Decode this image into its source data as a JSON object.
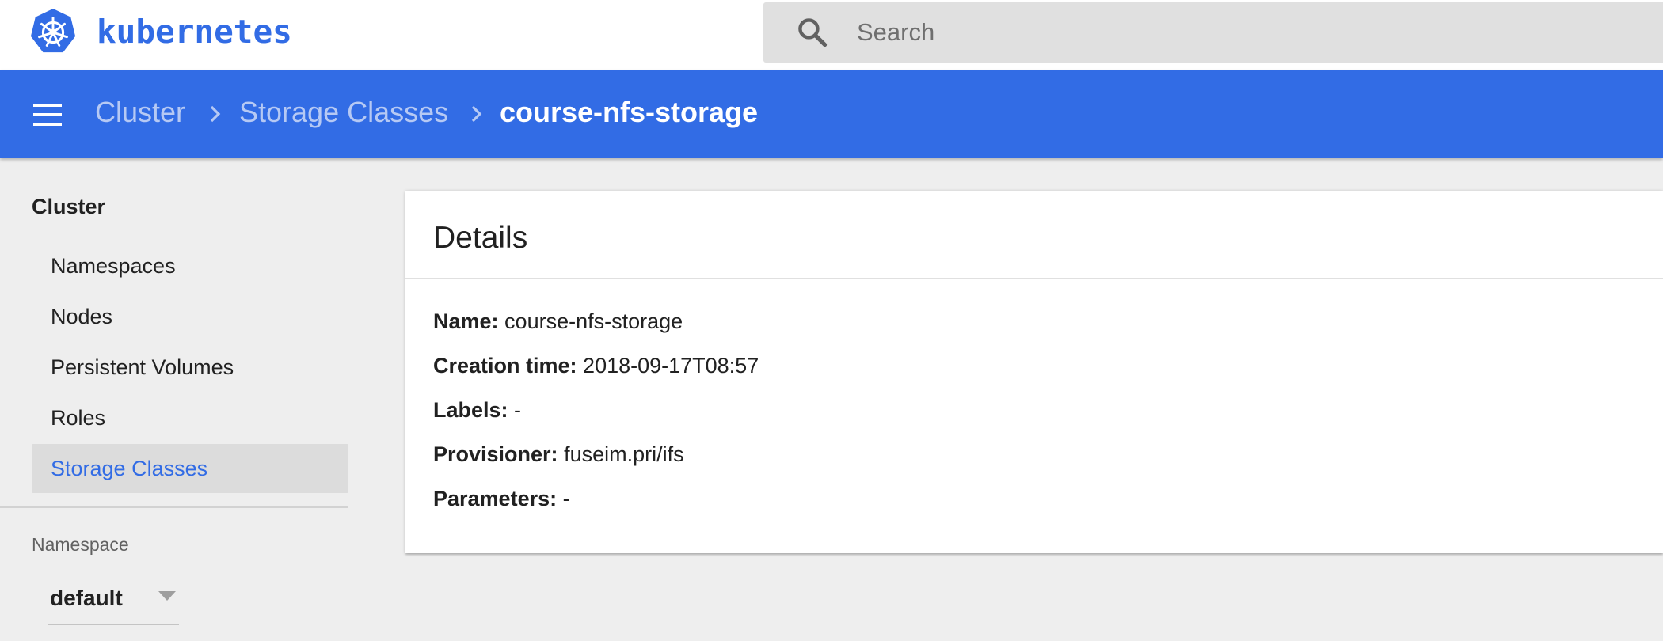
{
  "header": {
    "brand": "kubernetes",
    "search": {
      "placeholder": "Search",
      "value": ""
    },
    "brand_color": "#326ce5"
  },
  "toolbar": {
    "menu_icon": "hamburger-menu-icon",
    "breadcrumb": [
      {
        "label": "Cluster"
      },
      {
        "label": "Storage Classes"
      },
      {
        "label": "course-nfs-storage"
      }
    ],
    "separator_icon": "chevron-right-icon",
    "background": "#326ce5"
  },
  "sidebar": {
    "header": "Cluster",
    "items": [
      {
        "label": "Namespaces",
        "active": false
      },
      {
        "label": "Nodes",
        "active": false
      },
      {
        "label": "Persistent Volumes",
        "active": false
      },
      {
        "label": "Roles",
        "active": false
      },
      {
        "label": "Storage Classes",
        "active": true
      }
    ],
    "namespace": {
      "label": "Namespace",
      "selected": "default"
    }
  },
  "details": {
    "title": "Details",
    "rows": [
      {
        "key": "Name:",
        "value": "course-nfs-storage"
      },
      {
        "key": "Creation time:",
        "value": "2018-09-17T08:57"
      },
      {
        "key": "Labels:",
        "value": "-"
      },
      {
        "key": "Provisioner:",
        "value": "fuseim.pri/ifs"
      },
      {
        "key": "Parameters:",
        "value": "-"
      }
    ]
  }
}
